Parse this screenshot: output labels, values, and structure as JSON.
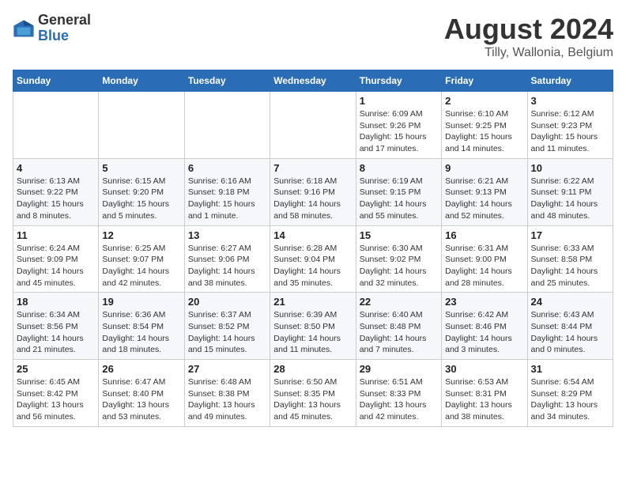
{
  "logo": {
    "general": "General",
    "blue": "Blue"
  },
  "title": "August 2024",
  "location": "Tilly, Wallonia, Belgium",
  "weekdays": [
    "Sunday",
    "Monday",
    "Tuesday",
    "Wednesday",
    "Thursday",
    "Friday",
    "Saturday"
  ],
  "weeks": [
    [
      {
        "day": "",
        "info": ""
      },
      {
        "day": "",
        "info": ""
      },
      {
        "day": "",
        "info": ""
      },
      {
        "day": "",
        "info": ""
      },
      {
        "day": "1",
        "info": "Sunrise: 6:09 AM\nSunset: 9:26 PM\nDaylight: 15 hours and 17 minutes."
      },
      {
        "day": "2",
        "info": "Sunrise: 6:10 AM\nSunset: 9:25 PM\nDaylight: 15 hours and 14 minutes."
      },
      {
        "day": "3",
        "info": "Sunrise: 6:12 AM\nSunset: 9:23 PM\nDaylight: 15 hours and 11 minutes."
      }
    ],
    [
      {
        "day": "4",
        "info": "Sunrise: 6:13 AM\nSunset: 9:22 PM\nDaylight: 15 hours and 8 minutes."
      },
      {
        "day": "5",
        "info": "Sunrise: 6:15 AM\nSunset: 9:20 PM\nDaylight: 15 hours and 5 minutes."
      },
      {
        "day": "6",
        "info": "Sunrise: 6:16 AM\nSunset: 9:18 PM\nDaylight: 15 hours and 1 minute."
      },
      {
        "day": "7",
        "info": "Sunrise: 6:18 AM\nSunset: 9:16 PM\nDaylight: 14 hours and 58 minutes."
      },
      {
        "day": "8",
        "info": "Sunrise: 6:19 AM\nSunset: 9:15 PM\nDaylight: 14 hours and 55 minutes."
      },
      {
        "day": "9",
        "info": "Sunrise: 6:21 AM\nSunset: 9:13 PM\nDaylight: 14 hours and 52 minutes."
      },
      {
        "day": "10",
        "info": "Sunrise: 6:22 AM\nSunset: 9:11 PM\nDaylight: 14 hours and 48 minutes."
      }
    ],
    [
      {
        "day": "11",
        "info": "Sunrise: 6:24 AM\nSunset: 9:09 PM\nDaylight: 14 hours and 45 minutes."
      },
      {
        "day": "12",
        "info": "Sunrise: 6:25 AM\nSunset: 9:07 PM\nDaylight: 14 hours and 42 minutes."
      },
      {
        "day": "13",
        "info": "Sunrise: 6:27 AM\nSunset: 9:06 PM\nDaylight: 14 hours and 38 minutes."
      },
      {
        "day": "14",
        "info": "Sunrise: 6:28 AM\nSunset: 9:04 PM\nDaylight: 14 hours and 35 minutes."
      },
      {
        "day": "15",
        "info": "Sunrise: 6:30 AM\nSunset: 9:02 PM\nDaylight: 14 hours and 32 minutes."
      },
      {
        "day": "16",
        "info": "Sunrise: 6:31 AM\nSunset: 9:00 PM\nDaylight: 14 hours and 28 minutes."
      },
      {
        "day": "17",
        "info": "Sunrise: 6:33 AM\nSunset: 8:58 PM\nDaylight: 14 hours and 25 minutes."
      }
    ],
    [
      {
        "day": "18",
        "info": "Sunrise: 6:34 AM\nSunset: 8:56 PM\nDaylight: 14 hours and 21 minutes."
      },
      {
        "day": "19",
        "info": "Sunrise: 6:36 AM\nSunset: 8:54 PM\nDaylight: 14 hours and 18 minutes."
      },
      {
        "day": "20",
        "info": "Sunrise: 6:37 AM\nSunset: 8:52 PM\nDaylight: 14 hours and 15 minutes."
      },
      {
        "day": "21",
        "info": "Sunrise: 6:39 AM\nSunset: 8:50 PM\nDaylight: 14 hours and 11 minutes."
      },
      {
        "day": "22",
        "info": "Sunrise: 6:40 AM\nSunset: 8:48 PM\nDaylight: 14 hours and 7 minutes."
      },
      {
        "day": "23",
        "info": "Sunrise: 6:42 AM\nSunset: 8:46 PM\nDaylight: 14 hours and 3 minutes."
      },
      {
        "day": "24",
        "info": "Sunrise: 6:43 AM\nSunset: 8:44 PM\nDaylight: 14 hours and 0 minutes."
      }
    ],
    [
      {
        "day": "25",
        "info": "Sunrise: 6:45 AM\nSunset: 8:42 PM\nDaylight: 13 hours and 56 minutes."
      },
      {
        "day": "26",
        "info": "Sunrise: 6:47 AM\nSunset: 8:40 PM\nDaylight: 13 hours and 53 minutes."
      },
      {
        "day": "27",
        "info": "Sunrise: 6:48 AM\nSunset: 8:38 PM\nDaylight: 13 hours and 49 minutes."
      },
      {
        "day": "28",
        "info": "Sunrise: 6:50 AM\nSunset: 8:35 PM\nDaylight: 13 hours and 45 minutes."
      },
      {
        "day": "29",
        "info": "Sunrise: 6:51 AM\nSunset: 8:33 PM\nDaylight: 13 hours and 42 minutes."
      },
      {
        "day": "30",
        "info": "Sunrise: 6:53 AM\nSunset: 8:31 PM\nDaylight: 13 hours and 38 minutes."
      },
      {
        "day": "31",
        "info": "Sunrise: 6:54 AM\nSunset: 8:29 PM\nDaylight: 13 hours and 34 minutes."
      }
    ]
  ]
}
